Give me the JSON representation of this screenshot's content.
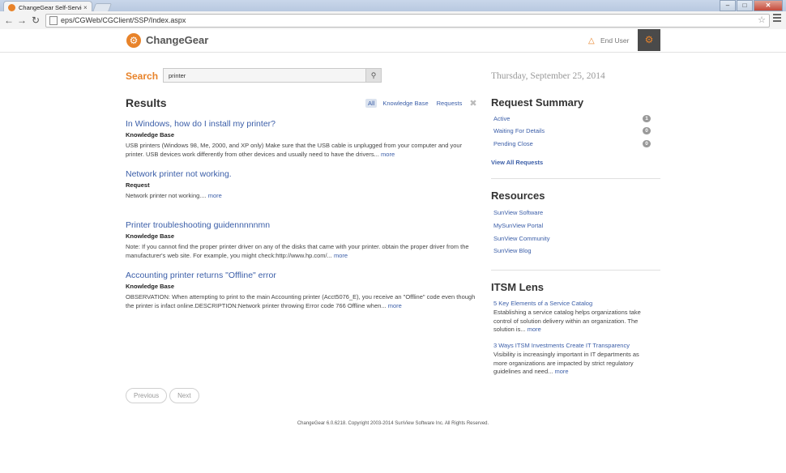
{
  "browser": {
    "tab_title": "ChangeGear Self-Service P",
    "tab_close": "×",
    "url": "eps/CGWeb/CGClient/SSP/Index.aspx",
    "win_min": "–",
    "win_max": "□",
    "win_close": "✕"
  },
  "header": {
    "logo_text": "ChangeGear",
    "user_label": "End User"
  },
  "search": {
    "label": "Search",
    "value": "printer"
  },
  "results": {
    "heading": "Results",
    "filters": {
      "all": "All",
      "kb": "Knowledge Base",
      "requests": "Requests"
    },
    "items": [
      {
        "title": "In Windows, how do I install my printer?",
        "type": "Knowledge Base",
        "snippet": "USB printers (Windows 98, Me, 2000, and XP only) Make sure that the USB cable is unplugged from your computer and your printer. USB devices work differently from other devices and usually need to have the drivers...",
        "more": "more"
      },
      {
        "title": "Network printer not working.",
        "type": "Request",
        "snippet": "Network printer not working....",
        "more": "more"
      },
      {
        "title": "Printer troubleshooting guidennnnnmn",
        "type": "Knowledge Base",
        "snippet": "Note: If you cannot find the proper printer driver on any of the disks that came with your printer. obtain the proper driver from the manufacturer's web site. For example, you might check:http://www.hp.com/...",
        "more": "more"
      },
      {
        "title": "Accounting printer returns \"Offline\" error",
        "type": "Knowledge Base",
        "snippet": "OBSERVATION: When attempting to print to the main Accounting printer (Acct5076_E), you receive an \"Offline\" code even though the printer is infact online.DESCRIPTION:Network printer throwing Error code 766 Offline when...",
        "more": "more"
      }
    ],
    "pager": {
      "previous": "Previous",
      "next": "Next"
    }
  },
  "sidebar": {
    "date": "Thursday, September 25, 2014",
    "summary": {
      "heading": "Request Summary",
      "rows": [
        {
          "label": "Active",
          "count": "1"
        },
        {
          "label": "Waiting For Details",
          "count": "0"
        },
        {
          "label": "Pending Close",
          "count": "0"
        }
      ],
      "view_all": "View All Requests"
    },
    "resources": {
      "heading": "Resources",
      "links": [
        "SunView Software",
        "MySunView Portal",
        "SunView Community",
        "SunView Blog"
      ]
    },
    "lens": {
      "heading": "ITSM Lens",
      "items": [
        {
          "title": "5 Key Elements of a Service Catalog",
          "text": "Establishing a service catalog helps organizations take control of solution delivery within an organization. The solution is...",
          "more": "more"
        },
        {
          "title": "3 Ways ITSM Investments Create IT Transparency",
          "text": "Visibility is increasingly important in IT departments as more organizations are impacted by strict regulatory guidelines and need...",
          "more": "more"
        }
      ]
    }
  },
  "footer": "ChangeGear 6.0.6218. Copyright 2003-2014 SunView Software Inc. All Rights Reserved.",
  "colors": {
    "accent": "#e8832a",
    "link": "#3b5ea8"
  },
  "icons": [
    "changegear-logo-icon",
    "user-warning-icon",
    "gear-icon",
    "search-icon",
    "close-icon",
    "star-icon",
    "menu-icon"
  ]
}
